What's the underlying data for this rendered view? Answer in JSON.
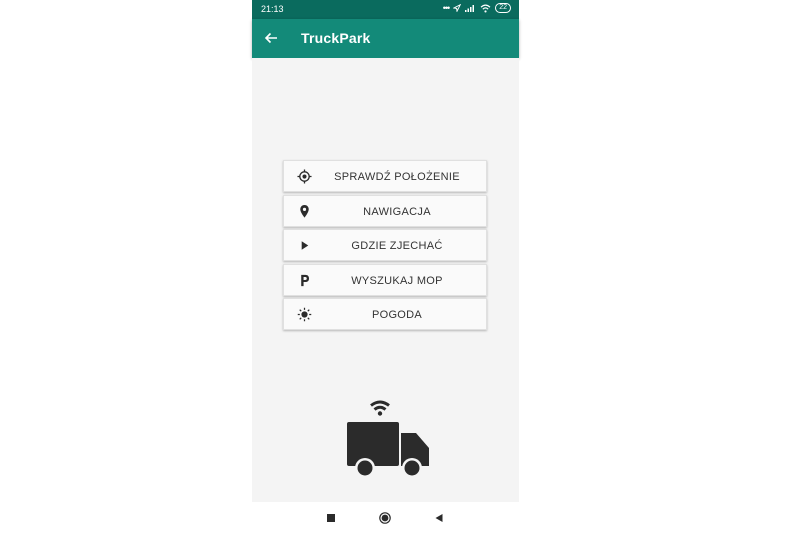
{
  "status_bar": {
    "time": "21:13",
    "battery": "22"
  },
  "app_bar": {
    "title": "TruckPark",
    "back_icon": "arrow-left-icon"
  },
  "menu": {
    "items": [
      {
        "label": "SPRAWDŹ POŁOŻENIE",
        "icon": "crosshair-icon"
      },
      {
        "label": "NAWIGACJA",
        "icon": "map-pin-icon"
      },
      {
        "label": "GDZIE ZJECHAĆ",
        "icon": "play-icon"
      },
      {
        "label": "WYSZUKAJ MOP",
        "icon": "parking-icon"
      },
      {
        "label": "POGODA",
        "icon": "sun-icon"
      }
    ]
  },
  "illustration": {
    "icon": "connected-truck-icon"
  },
  "nav_bar": {
    "buttons": [
      "recents-icon",
      "home-icon",
      "back-triangle-icon"
    ]
  },
  "colors": {
    "status_bar": "#0a6b5e",
    "app_bar": "#138a79",
    "background": "#f4f4f4",
    "button": "#fafafa",
    "text": "#333333",
    "icon": "#2b2b2b"
  }
}
